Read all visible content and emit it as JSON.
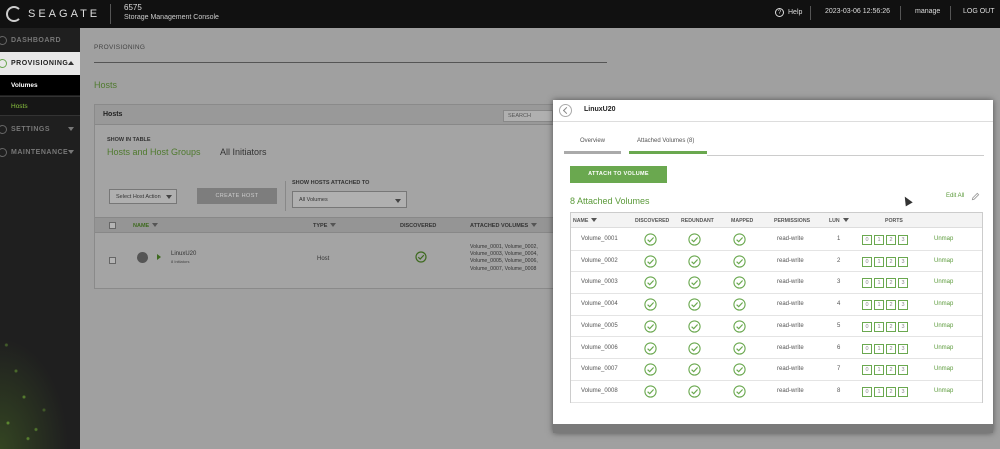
{
  "topbar": {
    "brand": "SEAGATE",
    "system_name": "6575",
    "system_subtitle": "Storage Management Console",
    "help": "Help",
    "datetime": "2023-03-06 12:56:26",
    "user": "manage",
    "logout": "LOG OUT"
  },
  "sidebar": {
    "items": [
      {
        "label": "DASHBOARD"
      },
      {
        "label": "PROVISIONING"
      },
      {
        "label": "SETTINGS"
      },
      {
        "label": "MAINTENANCE"
      }
    ],
    "sub_items": [
      {
        "label": "Volumes"
      },
      {
        "label": "Hosts"
      }
    ]
  },
  "main": {
    "breadcrumb": "PROVISIONING",
    "page_title": "Hosts",
    "panel_title": "Hosts",
    "search_placeholder": "SEARCH",
    "show_in_table_label": "SHOW IN TABLE",
    "show_options": [
      "Hosts and Host Groups",
      "All Initiators"
    ],
    "host_action": "Select Host Action",
    "create_host": "CREATE HOST",
    "show_attached_label": "SHOW HOSTS ATTACHED TO",
    "attached_filter": "All Volumes",
    "columns": [
      "NAME",
      "TYPE",
      "DISCOVERED",
      "ATTACHED VOLUMES"
    ],
    "row": {
      "name": "LinuxU20",
      "subtitle": "8 Initiators",
      "type": "Host",
      "volumes": "Volume_0001, Volume_0002, Volume_0003, Volume_0004, Volume_0005, Volume_0006, Volume_0007, Volume_0008"
    }
  },
  "modal": {
    "title": "LinuxU20",
    "tabs": [
      "Overview",
      "Attached Volumes (8)"
    ],
    "attach_button": "ATTACH TO VOLUME",
    "count_label": "8 Attached Volumes",
    "edit_all": "Edit All",
    "columns": [
      "NAME",
      "DISCOVERED",
      "REDUNDANT",
      "MAPPED",
      "PERMISSIONS",
      "LUN",
      "PORTS"
    ],
    "port_labels": [
      "0",
      "1",
      "2",
      "3"
    ],
    "unmap_label": "Unmap",
    "rows": [
      {
        "name": "Volume_0001",
        "permissions": "read-write",
        "lun": "1"
      },
      {
        "name": "Volume_0002",
        "permissions": "read-write",
        "lun": "2"
      },
      {
        "name": "Volume_0003",
        "permissions": "read-write",
        "lun": "3"
      },
      {
        "name": "Volume_0004",
        "permissions": "read-write",
        "lun": "4"
      },
      {
        "name": "Volume_0005",
        "permissions": "read-write",
        "lun": "5"
      },
      {
        "name": "Volume_0006",
        "permissions": "read-write",
        "lun": "6"
      },
      {
        "name": "Volume_0007",
        "permissions": "read-write",
        "lun": "7"
      },
      {
        "name": "Volume_0008",
        "permissions": "read-write",
        "lun": "8"
      }
    ]
  },
  "colors": {
    "accent": "#6aa84f",
    "topbar": "#111111",
    "sidebar": "#1f1f1f"
  }
}
